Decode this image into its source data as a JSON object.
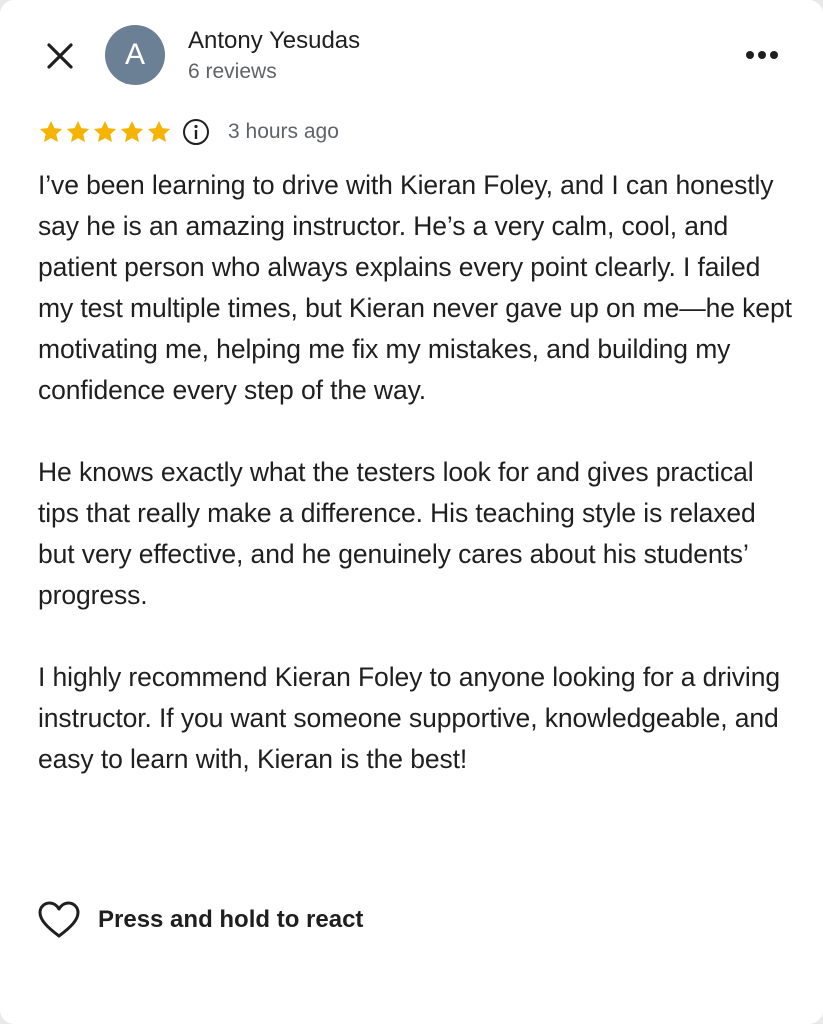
{
  "reviewer": {
    "avatar_letter": "A",
    "avatar_color": "#6b7f95",
    "name": "Antony Yesudas",
    "review_count": "6 reviews"
  },
  "header": {
    "close_icon": "close-icon",
    "more_icon": "more-horizontal-icon"
  },
  "rating": {
    "stars": 5,
    "max_stars": 5,
    "star_color": "#f4b400",
    "info_icon": "info-icon",
    "time_ago": "3 hours ago"
  },
  "review": {
    "paragraphs": [
      "I’ve been learning to drive with Kieran Foley, and I can honestly say he is an amazing instructor. He’s a very calm, cool, and patient person who always explains every point clearly. I failed my test multiple times, but Kieran never gave up on me—he kept motivating me, helping me fix my mistakes, and building my confidence every step of the way.",
      "He knows exactly what the testers look for and gives practical tips that really make a difference. His teaching style is relaxed but very effective, and he genuinely cares about his students’ progress.",
      "I highly recommend Kieran Foley to anyone looking for a driving instructor. If you want someone supportive, knowledgeable, and easy to learn with, Kieran is the best!"
    ]
  },
  "react": {
    "icon": "heart-icon",
    "label": "Press and hold to react"
  }
}
